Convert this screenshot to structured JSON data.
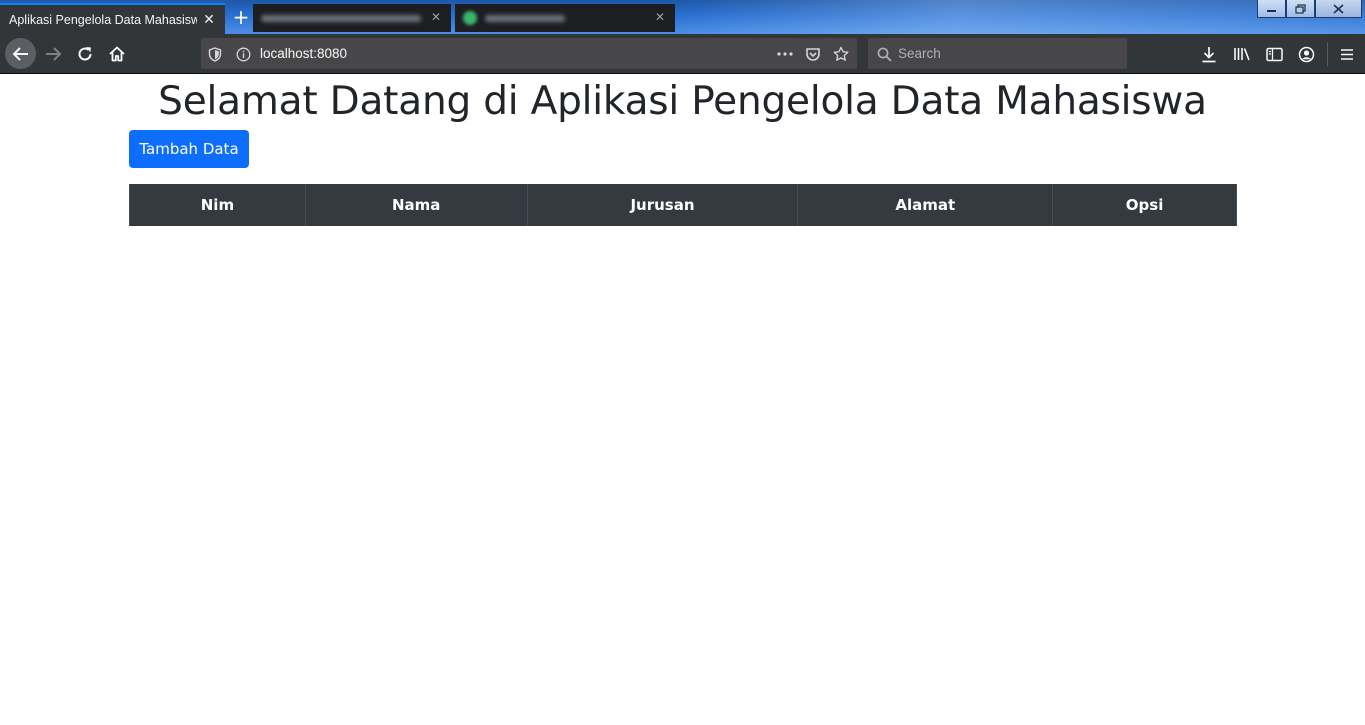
{
  "browser": {
    "active_tab_title": "Aplikasi Pengelola Data Mahasiswa",
    "url": "localhost:8080",
    "search_placeholder": "Search"
  },
  "page": {
    "title": "Selamat Datang di Aplikasi Pengelola Data Mahasiswa",
    "add_button_label": "Tambah Data"
  },
  "table": {
    "columns": [
      "Nim",
      "Nama",
      "Jurusan",
      "Alamat",
      "Opsi"
    ],
    "rows": []
  }
}
